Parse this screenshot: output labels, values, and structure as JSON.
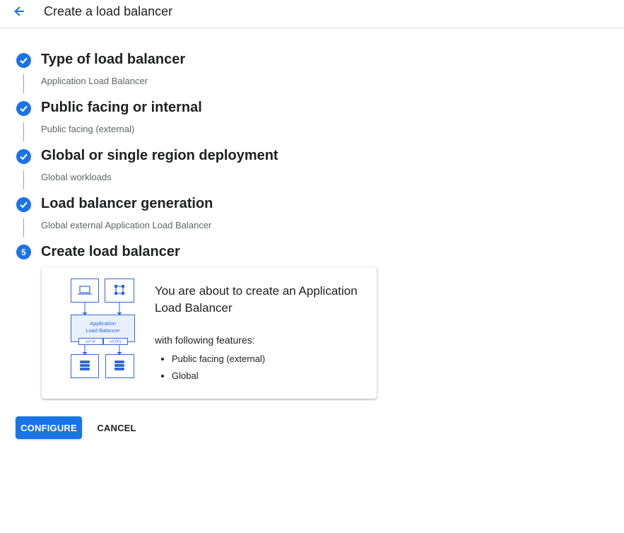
{
  "header": {
    "back_icon": "arrow-back-icon",
    "title": "Create a load balancer"
  },
  "steps": [
    {
      "status": "complete",
      "icon": "check-circle-icon",
      "title": "Type of load balancer",
      "value": "Application Load Balancer"
    },
    {
      "status": "complete",
      "icon": "check-circle-icon",
      "title": "Public facing or internal",
      "value": "Public facing (external)"
    },
    {
      "status": "complete",
      "icon": "check-circle-icon",
      "title": "Global or single region deployment",
      "value": "Global workloads"
    },
    {
      "status": "complete",
      "icon": "check-circle-icon",
      "title": "Load balancer generation",
      "value": "Global external Application Load Balancer"
    },
    {
      "status": "current",
      "number": "5",
      "title": "Create load balancer"
    }
  ],
  "summary_card": {
    "diagram": {
      "lb_label_line1": "Application",
      "lb_label_line2": "Load Balancer",
      "protocol_left": "HTTP",
      "protocol_right": "HTTPS",
      "icons": [
        "laptop-icon",
        "network-icon",
        "database-icon",
        "database-icon"
      ]
    },
    "heading": "You are about to create an Application Load Balancer",
    "subheading": "with following features:",
    "features": [
      "Public facing (external)",
      "Global"
    ]
  },
  "actions": {
    "configure_label": "CONFIGURE",
    "cancel_label": "CANCEL"
  },
  "colors": {
    "accent": "#1a73e8",
    "diagram_stroke": "#3367d6",
    "divider": "#dadce0"
  }
}
